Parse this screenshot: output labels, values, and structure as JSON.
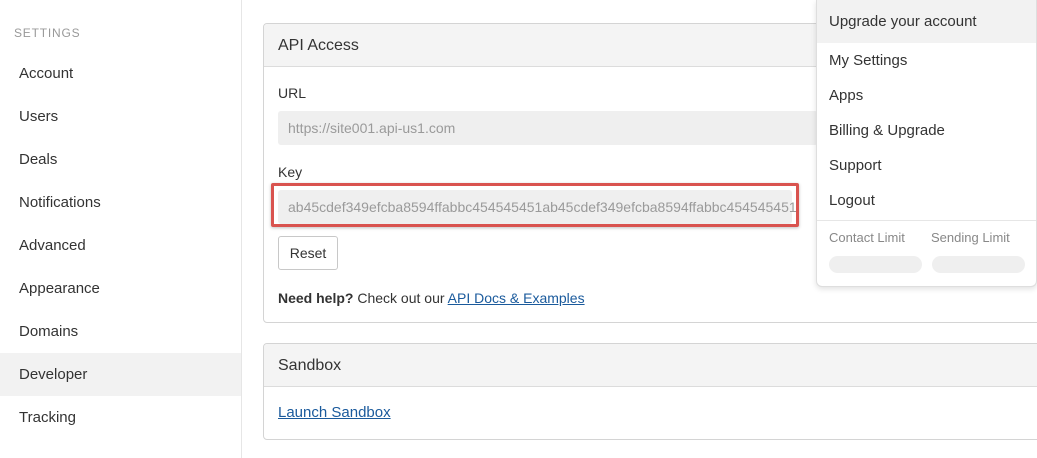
{
  "sidebar": {
    "heading": "SETTINGS",
    "items": [
      {
        "label": "Account"
      },
      {
        "label": "Users"
      },
      {
        "label": "Deals"
      },
      {
        "label": "Notifications"
      },
      {
        "label": "Advanced"
      },
      {
        "label": "Appearance"
      },
      {
        "label": "Domains"
      },
      {
        "label": "Developer",
        "active": true
      },
      {
        "label": "Tracking"
      }
    ]
  },
  "api_access": {
    "title": "API Access",
    "url_label": "URL",
    "url_value": "https://site001.api-us1.com",
    "key_label": "Key",
    "key_value": "ab45cdef349efcba8594ffabbc454545451ab45cdef349efcba8594ffabbc454545451",
    "reset_label": "Reset",
    "help_bold": "Need help?",
    "help_text": " Check out our ",
    "help_link": "API Docs & Examples"
  },
  "sandbox": {
    "title": "Sandbox",
    "link": "Launch Sandbox"
  },
  "account_menu": {
    "upgrade": "Upgrade your account",
    "items": [
      {
        "label": "My Settings"
      },
      {
        "label": "Apps"
      },
      {
        "label": "Billing & Upgrade"
      },
      {
        "label": "Support"
      },
      {
        "label": "Logout"
      }
    ],
    "contact_limit_label": "Contact Limit",
    "sending_limit_label": "Sending Limit"
  },
  "colors": {
    "highlight": "#d9534f",
    "link": "#1a5a9c",
    "active_bg": "#f2f2f2"
  }
}
